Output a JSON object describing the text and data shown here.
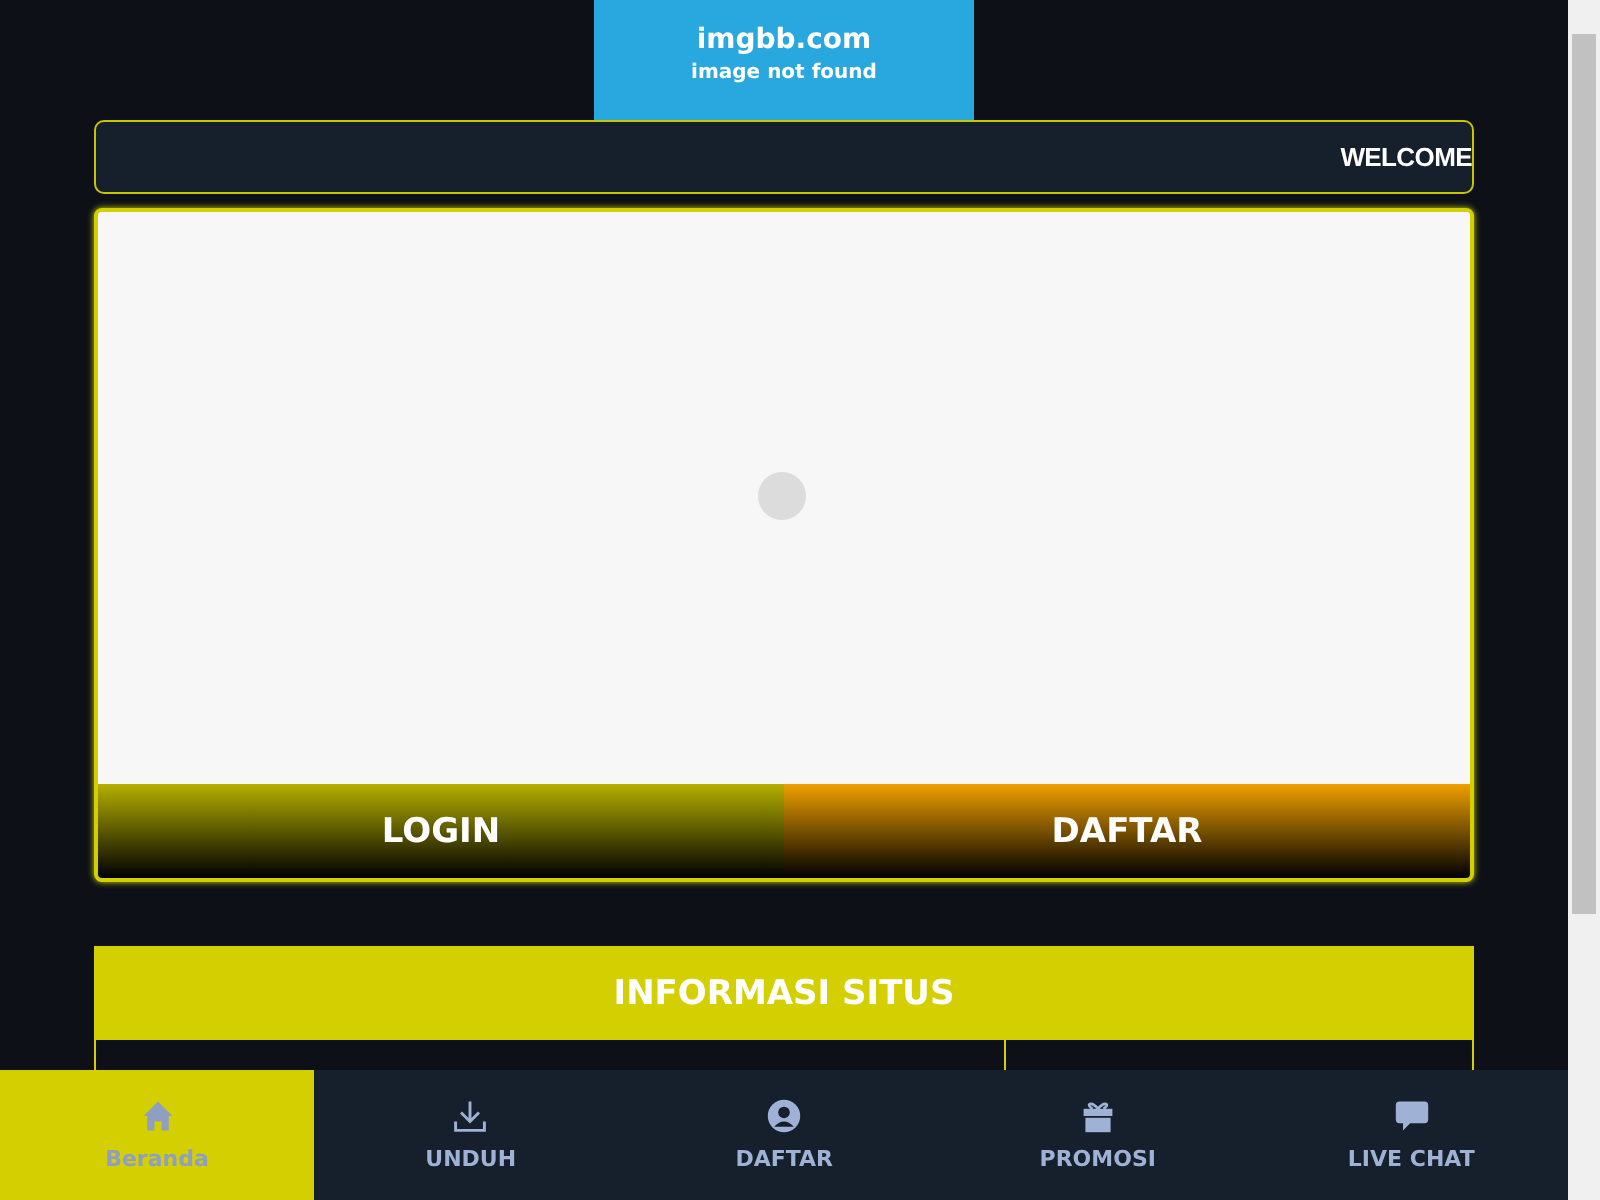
{
  "logo": {
    "title": "imgbb.com",
    "subtitle": "image not found"
  },
  "marquee": {
    "text": "WELCOME"
  },
  "auth_buttons": [
    {
      "label": "LOGIN",
      "kind": "login"
    },
    {
      "label": "DAFTAR",
      "kind": "register"
    }
  ],
  "info": {
    "title": "INFORMASI SITUS"
  },
  "bottom_nav": [
    {
      "label": "Beranda",
      "selected": true
    },
    {
      "label": "UNDUH",
      "selected": false
    },
    {
      "label": "DAFTAR",
      "selected": false
    },
    {
      "label": "PROMOSI",
      "selected": false
    },
    {
      "label": "LIVE CHAT",
      "selected": false
    }
  ]
}
